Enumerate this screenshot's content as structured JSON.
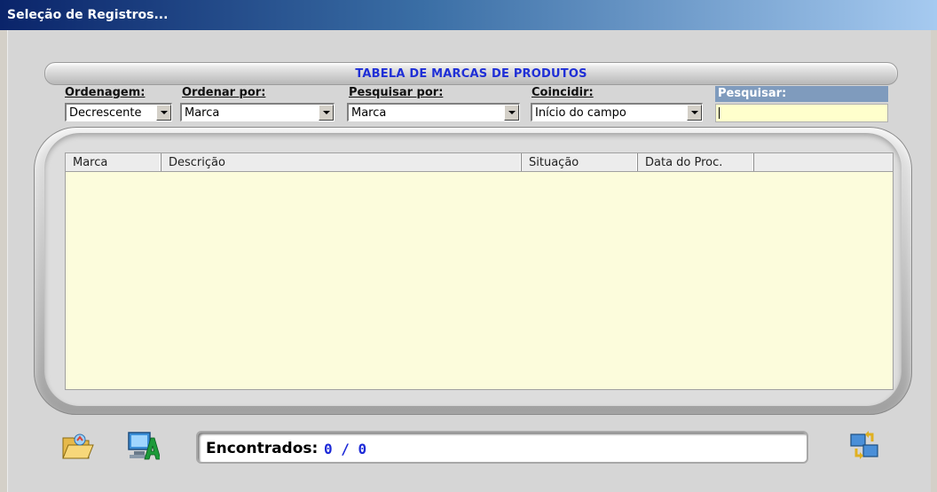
{
  "window": {
    "title": "Seleção de Registros..."
  },
  "header": {
    "title": "TABELA DE MARCAS DE PRODUTOS"
  },
  "filters": {
    "ordenagem": {
      "label": "Ordenagem:",
      "value": "Decrescente"
    },
    "ordenar_por": {
      "label": "Ordenar por:",
      "value": "Marca"
    },
    "pesquisar_por": {
      "label": "Pesquisar por:",
      "value": "Marca"
    },
    "coincidir": {
      "label": "Coincidir:",
      "value": "Início do campo"
    },
    "pesquisar": {
      "label": "Pesquisar:",
      "value": ""
    }
  },
  "table": {
    "columns": [
      "Marca",
      "Descrição",
      "Situação",
      "Data do Proc."
    ],
    "rows": []
  },
  "footer": {
    "found_label": "Encontrados:",
    "found_count": "0 / 0"
  },
  "icons": {
    "open": "open-folder-icon",
    "report": "report-computer-icon",
    "exchange": "exchange-icon"
  },
  "colors": {
    "accent": "#1f2fd6",
    "grid_bg": "#fcfcdc",
    "search_bg": "#ffffcc",
    "search_label_bg": "#7f9bbd"
  }
}
